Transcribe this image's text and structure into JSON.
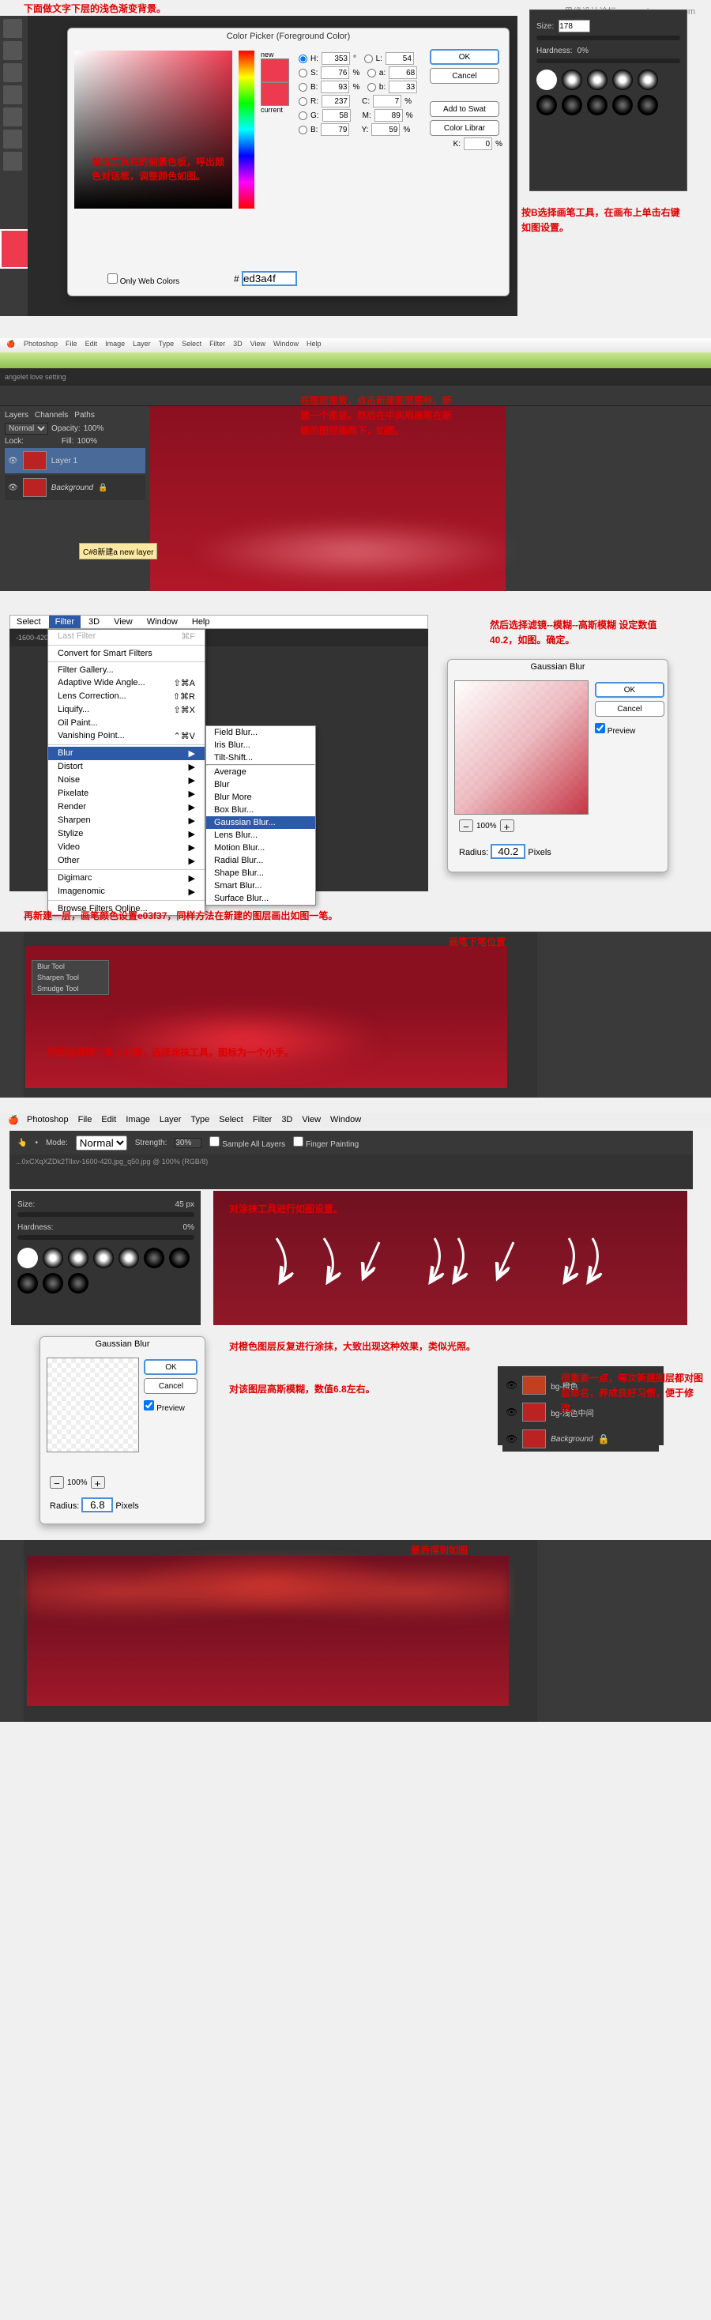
{
  "watermark": "思缘设计论坛  www.missyuan.com",
  "sec1": {
    "heading": "下面做文字下层的浅色渐变背景。",
    "colorPicker": {
      "title": "Color Picker (Foreground Color)",
      "newLabel": "new",
      "currentLabel": "current",
      "buttons": {
        "ok": "OK",
        "cancel": "Cancel",
        "addSwatch": "Add to Swat",
        "library": "Color Librar"
      },
      "H": "353",
      "S": "76",
      "B": "93",
      "R": "237",
      "G": "58",
      "Bl": "79",
      "L": "54",
      "a": "68",
      "b": "33",
      "C": "7",
      "M": "89",
      "Y": "59",
      "K": "0",
      "hex": "ed3a4f",
      "onlyWeb": "Only Web Colors"
    },
    "tip": "单击工具栏的前景色板，呼出颜色对话框，调整颜色如图。",
    "brush": {
      "sizeLabel": "Size:",
      "sizeValue": "178",
      "hardnessLabel": "Hardness:",
      "hardnessValue": "0%"
    },
    "tip2": "按B选择画笔工具，在画布上单击右键如图设置。"
  },
  "sec2": {
    "menubar": [
      "Photoshop",
      "File",
      "Edit",
      "Image",
      "Layer",
      "Type",
      "Select",
      "Filter",
      "3D",
      "View",
      "Window",
      "Help"
    ],
    "toptab": "angelet love    setting",
    "layersPanel": {
      "tabs": [
        "Layers",
        "Channels",
        "Paths"
      ],
      "blend": "Normal",
      "opacityLabel": "Opacity:",
      "opacityValue": "100%",
      "lockLabel": "Lock:",
      "fillLabel": "Fill:",
      "fillValue": "100%",
      "layers": [
        {
          "name": "Layer 1"
        },
        {
          "name": "Background"
        }
      ],
      "tooltip": "C#8新建a new layer"
    },
    "tip": "在图层面板，点击新建图层图标，新建一个图层。然后在中间用画笔在新建的图层画两下，如图。"
  },
  "sec3": {
    "menu": [
      "Select",
      "Filter",
      "3D",
      "View",
      "Window",
      "Help"
    ],
    "filterItems": [
      {
        "label": "Last Filter",
        "sc": "⌘F",
        "gray": true
      },
      {
        "label": "Convert for Smart Filters"
      },
      {
        "label": "Filter Gallery..."
      },
      {
        "label": "Adaptive Wide Angle...",
        "sc": "⇧⌘A"
      },
      {
        "label": "Lens Correction...",
        "sc": "⇧⌘R"
      },
      {
        "label": "Liquify...",
        "sc": "⇧⌘X"
      },
      {
        "label": "Oil Paint..."
      },
      {
        "label": "Vanishing Point...",
        "sc": "⌃⌘V"
      },
      {
        "label": "Blur",
        "hl": true,
        "sub": true
      },
      {
        "label": "Distort",
        "sub": true
      },
      {
        "label": "Noise",
        "sub": true
      },
      {
        "label": "Pixelate",
        "sub": true
      },
      {
        "label": "Render",
        "sub": true
      },
      {
        "label": "Sharpen",
        "sub": true
      },
      {
        "label": "Stylize",
        "sub": true
      },
      {
        "label": "Video",
        "sub": true
      },
      {
        "label": "Other",
        "sub": true
      },
      {
        "label": "Digimarc",
        "sub": true
      },
      {
        "label": "Imagenomic",
        "sub": true
      },
      {
        "label": "Browse Filters Online..."
      }
    ],
    "blurSub": [
      "Field Blur...",
      "Iris Blur...",
      "Tilt-Shift...",
      "Average",
      "Blur",
      "Blur More",
      "Box Blur...",
      "Gaussian Blur...",
      "Lens Blur...",
      "Motion Blur...",
      "Radial Blur...",
      "Shape Blur...",
      "Smart Blur...",
      "Surface Blur..."
    ],
    "blurHighlight": "Gaussian Blur...",
    "tip": "然后选择滤镜--模糊--高斯模糊 设定数值40.2，如图。确定。",
    "gblur": {
      "title": "Gaussian Blur",
      "ok": "OK",
      "cancel": "Cancel",
      "preview": "Preview",
      "radiusLabel": "Radius:",
      "radiusValue": "40.2",
      "pixels": "Pixels",
      "zoom": "100%"
    },
    "docTab": "-1600-420...OxCXqXZDk2Tllxv-1600-420.jpg @ 1..."
  },
  "sec4": {
    "intro": "再新建一层，画笔颜色设置e03f37，同样方法在新建的图层画出如图一笔。",
    "label": "画笔下笔位置",
    "tip": "然后在模糊工具上右键，选择涂抹工具，图标为一个小手。"
  },
  "sec5": {
    "menubar": [
      "Photoshop",
      "File",
      "Edit",
      "Image",
      "Layer",
      "Type",
      "Select",
      "Filter",
      "3D",
      "View",
      "Window"
    ],
    "options": {
      "modeLabel": "Mode:",
      "mode": "Normal",
      "strengthLabel": "Strength:",
      "strength": "30%",
      "sampleAll": "Sample All Layers",
      "finger": "Finger Painting"
    },
    "docTab": "...0xCXqXZDk2Tllxv-1600-420.jpg_q50.jpg @ 100% (RGB/8)",
    "sizePanel": {
      "sizeLabel": "Size:",
      "sizeValue": "45 px",
      "hardnessLabel": "Hardness:",
      "hardnessValue": "0%"
    },
    "tip1": "对涂抹工具进行如图设置。",
    "tip2": "对橙色图层反复进行涂抹，大致出现这种效果，类似光照。",
    "tip3": "对该图层高斯模糊，数值6.8左右。",
    "tip4": "很重要一点，每次新建图层都对图层命名，养成良好习惯，便于修改。",
    "gblur": {
      "title": "Gaussian Blur",
      "ok": "OK",
      "cancel": "Cancel",
      "preview": "Preview",
      "radiusLabel": "Radius:",
      "radiusValue": "6.8",
      "pixels": "Pixels",
      "zoom": "100%"
    },
    "layers": [
      "bg-橙色",
      "bg-浅色中间",
      "Background"
    ]
  },
  "sec6": {
    "label": "最后得到如图"
  }
}
